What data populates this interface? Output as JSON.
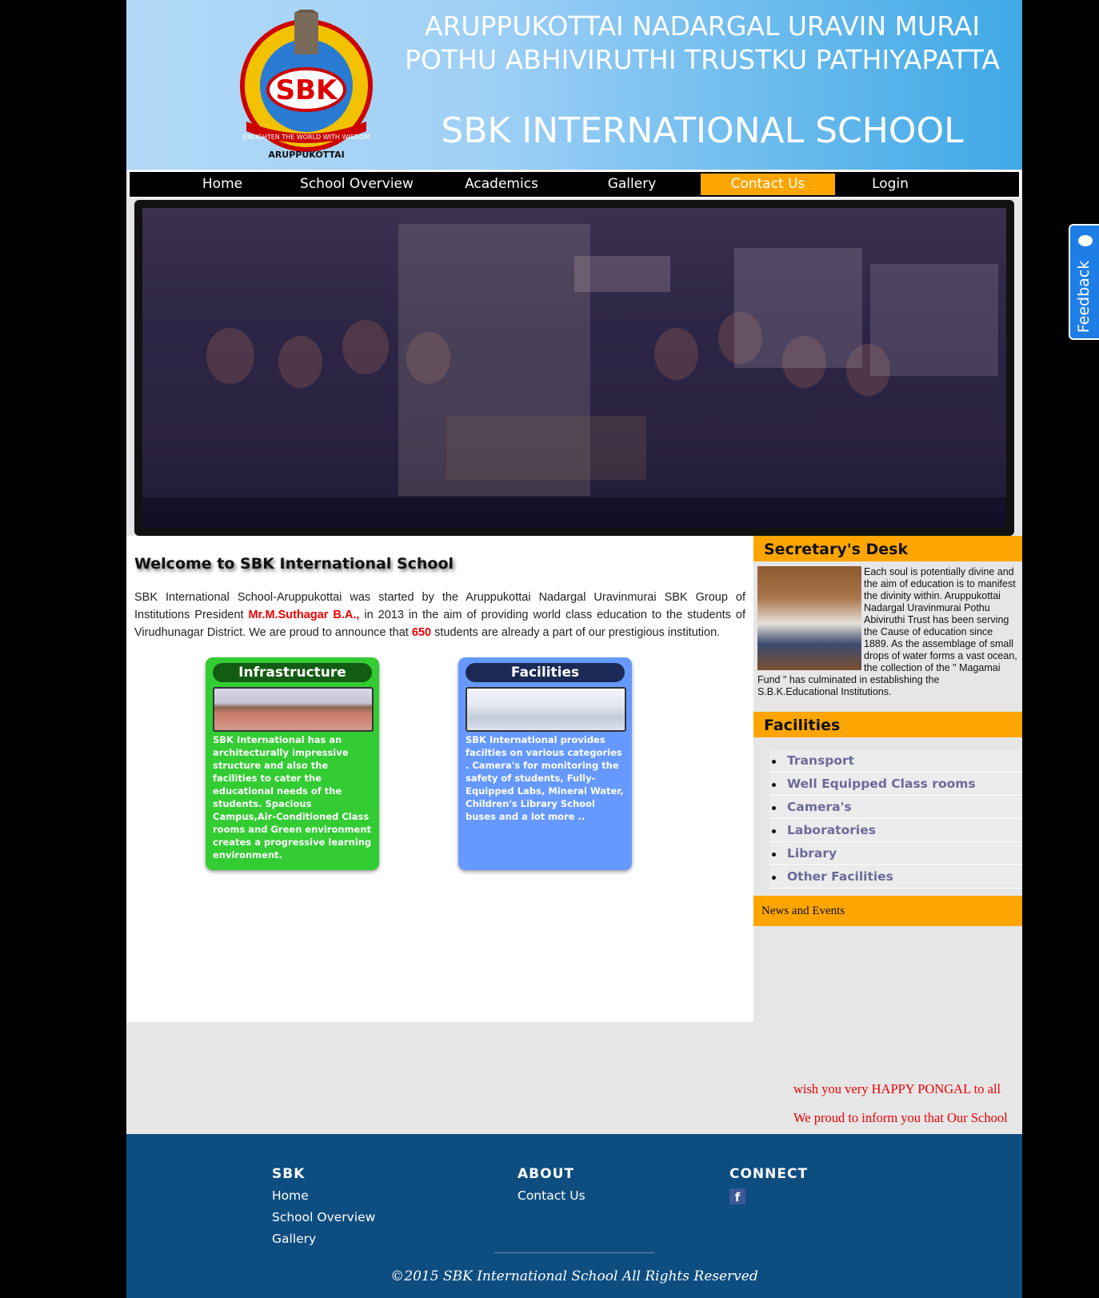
{
  "header": {
    "trust_line1": "ARUPPUKOTTAI NADARGAL URAVIN MURAI",
    "trust_line2": "POTHU ABHIVIRUTHI TRUSTKU PATHIYAPATTA",
    "school_name": "SBK INTERNATIONAL SCHOOL",
    "logo_text": "SBK",
    "logo_motto": "ENLIGHTEN THE WORLD WITH WISDOM",
    "logo_place": "ARUPPUKOTTAI"
  },
  "nav": {
    "items": [
      {
        "label": "Home"
      },
      {
        "label": "School Overview"
      },
      {
        "label": "Academics"
      },
      {
        "label": "Gallery"
      },
      {
        "label": "Contact Us",
        "active": true
      },
      {
        "label": "Login"
      }
    ]
  },
  "main": {
    "welcome_title": "Welcome to SBK International School",
    "intro_part1": "SBK International School-Aruppukottai was started by the Aruppukottai Nadargal Uravinmurai SBK Group of Institutions President ",
    "intro_president": "Mr.M.Suthagar B.A.,",
    "intro_part2": " in 2013 in the aim of providing world class education to the students of Virudhunagar District. We are proud to announce that ",
    "intro_count": "650",
    "intro_part3": " students are already a part of our prestigious institution.",
    "cards": [
      {
        "title": "Infrastructure",
        "text": "SBK International has an architecturally impressive structure and also the facilities to cater the educational needs of the students. Spacious Campus,Air-Conditioned Class rooms and Green environment creates a progressive learning environment."
      },
      {
        "title": "Facilities",
        "text": "SBK International provides facilties on various categories . Camera's for monitoring the safety of students, Fully-Equipped Labs, Mineral Water, Children's Library School buses and a lot more .."
      }
    ]
  },
  "sidebar": {
    "secretary_title": "Secretary's Desk",
    "secretary_text": "Each soul is potentially divine and the aim of education is to manifest the divinity within. Aruppukottai Nadargal Uravinmurai Pothu Abiviruthi Trust has been serving the Cause of education since 1889. As the assemblage of small drops of water forms a vast ocean, the collection of the \" Magamai Fund \" has culminated in establishing the S.B.K.Educational Institutions.",
    "facilities_title": "Facilities",
    "facilities": [
      "Transport",
      "Well Equipped Class rooms",
      "Camera's",
      "Laboratories",
      "Library",
      "Other Facilities"
    ],
    "news_title": "News and Events",
    "news_items": [
      "wish you very HAPPY PONGAL to all",
      "We proud to inform you that Our School"
    ]
  },
  "footer": {
    "col1_title": "SBK",
    "col1_links": [
      "Home",
      "School Overview",
      "Gallery"
    ],
    "col2_title": "ABOUT",
    "col2_links": [
      "Contact Us"
    ],
    "col3_title": "CONNECT",
    "facebook_icon": "facebook-icon",
    "copyright": "©2015 SBK International School All Rights Reserved"
  },
  "feedback": {
    "label": "Feedback",
    "icon": "chat-icon"
  },
  "colors": {
    "accent": "#ffa500",
    "footer": "#0e4d80",
    "nav": "#000000",
    "infra_card": "#33cc33",
    "facilities_card": "#6699ff",
    "highlight": "#ee0000"
  }
}
